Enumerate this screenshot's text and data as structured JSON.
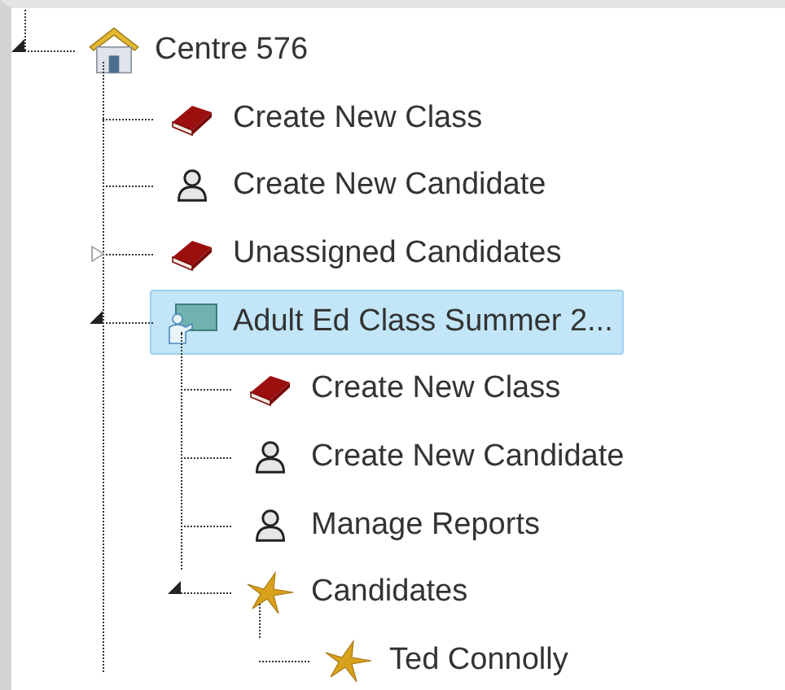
{
  "tree": [
    {
      "label": "Centre 576",
      "kind": "house",
      "expanded": true,
      "selected": false,
      "children": [
        {
          "label": "Create New Class",
          "kind": "book",
          "selected": false
        },
        {
          "label": "Create New Candidate",
          "kind": "person",
          "selected": false
        },
        {
          "label": "Unassigned Candidates",
          "kind": "book",
          "expanded": false,
          "selected": false
        },
        {
          "label": "Adult Ed Class Summer 2...",
          "kind": "class",
          "expanded": true,
          "selected": true,
          "children": [
            {
              "label": "Create New Class",
              "kind": "book",
              "selected": false
            },
            {
              "label": "Create New Candidate",
              "kind": "person",
              "selected": false
            },
            {
              "label": "Manage Reports",
              "kind": "person",
              "selected": false
            },
            {
              "label": "Candidates",
              "kind": "star",
              "expanded": true,
              "selected": false,
              "children": [
                {
                  "label": "Ted Connolly",
                  "kind": "star",
                  "selected": false
                }
              ]
            }
          ]
        }
      ]
    }
  ]
}
